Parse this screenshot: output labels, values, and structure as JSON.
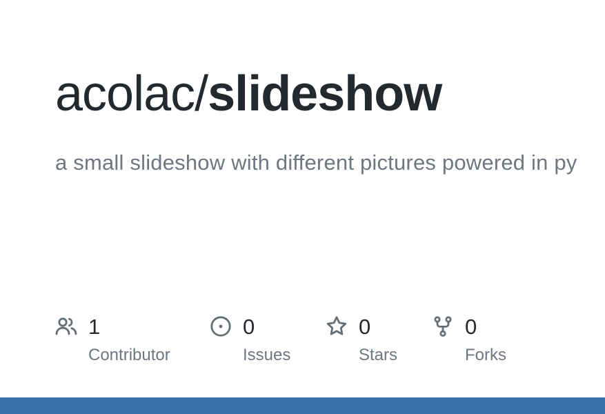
{
  "repo": {
    "owner": "acolac/",
    "name": "slideshow",
    "description": "a small slideshow with different pictures powered in py"
  },
  "stats": [
    {
      "icon": "people-icon",
      "count": "1",
      "label": "Contributor"
    },
    {
      "icon": "issue-opened-icon",
      "count": "0",
      "label": "Issues"
    },
    {
      "icon": "star-icon",
      "count": "0",
      "label": "Stars"
    },
    {
      "icon": "repo-forked-icon",
      "count": "0",
      "label": "Forks"
    }
  ],
  "colors": {
    "title": "#24292f",
    "muted": "#6e7681",
    "icon": "#656d76",
    "language_bar": "#3572a5"
  }
}
